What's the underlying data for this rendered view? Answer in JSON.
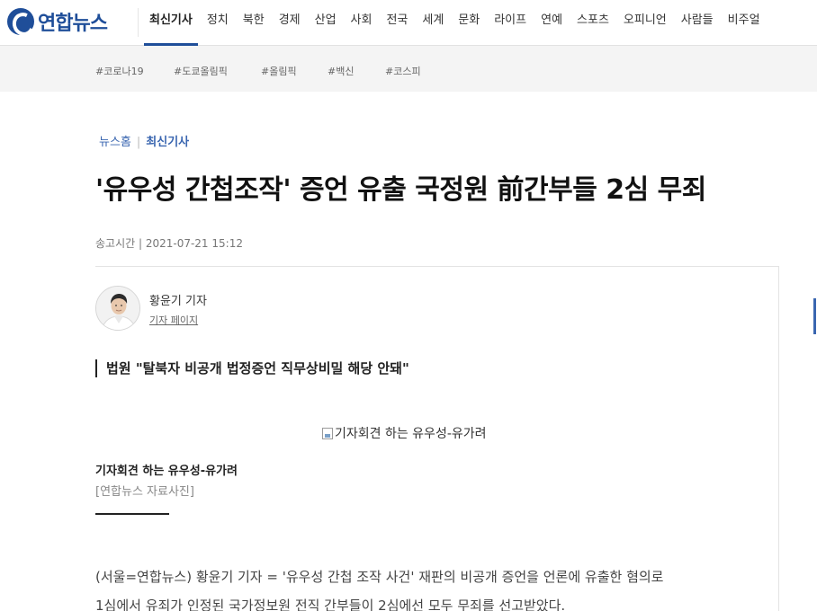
{
  "header": {
    "logo_text": "연합뉴스",
    "nav": [
      "최신기사",
      "정치",
      "북한",
      "경제",
      "산업",
      "사회",
      "전국",
      "세계",
      "문화",
      "라이프",
      "연예",
      "스포츠",
      "오피니언",
      "사람들",
      "비주얼"
    ],
    "active_nav": "최신기사",
    "brand_color": "#1f4e99"
  },
  "hashtags": [
    "#코로나19",
    "#도쿄올림픽",
    "#올림픽",
    "#백신",
    "#코스피"
  ],
  "article": {
    "breadcrumb": {
      "home": "뉴스홈",
      "separator": "|",
      "current": "최신기사"
    },
    "headline": "'유우성 간첩조작' 증언 유출 국정원 前간부들 2심 무죄",
    "send_time": "송고시간 | 2021-07-21 15:12",
    "reporter": {
      "name": "황윤기 기자",
      "page_link": "기자 페이지"
    },
    "subtitle": "법원 \"탈북자 비공개 법정증언 직무상비밀 해당 안돼\"",
    "photo": {
      "alt": "기자회견 하는 유우성-유가려",
      "caption": "기자회견 하는 유우성-유가려",
      "source": "[연합뉴스 자료사진]"
    },
    "body": [
      "(서울=연합뉴스) 황윤기 기자 = '유우성 간첩 조작 사건' 재판의 비공개 증언을 언론에 유출한 혐의로",
      "1심에서 유죄가 인정된 국가정보원 전직 간부들이 2심에선 모두 무죄를 선고받았다."
    ]
  }
}
